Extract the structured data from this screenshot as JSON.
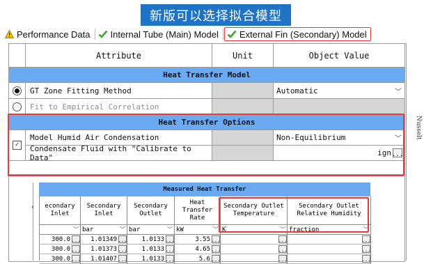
{
  "banner": {
    "text": "新版可以选择拟合模型"
  },
  "tabs": [
    {
      "label": "Performance Data",
      "icon": "warning-icon"
    },
    {
      "label": "Internal Tube (Main) Model",
      "icon": "check-icon"
    },
    {
      "label": "External Fin (Secondary) Model",
      "icon": "check-icon"
    }
  ],
  "grid": {
    "headers": {
      "attribute": "Attribute",
      "unit": "Unit",
      "value": "Object Value"
    },
    "sections": {
      "model": "Heat Transfer Model",
      "options": "Heat Transfer Options"
    },
    "rows": {
      "gt_zone": {
        "label": "GT Zone Fitting Method",
        "value": "Automatic"
      },
      "fit_empirical": {
        "label": "Fit to Empirical Correlation"
      },
      "humid_air": {
        "label": "Model Humid Air Condensation",
        "value": "Non-Equilibrium"
      },
      "condensate": {
        "label": "Condensate Fluid with \"Calibrate to Data\"",
        "value": "ign"
      }
    }
  },
  "side_label": "Nusselt",
  "ellipsis": "...",
  "measured": {
    "title": "Measured Heat Transfer",
    "columns": [
      {
        "header": "econdary\nInlet",
        "unit": "",
        "values": [
          "300.0",
          "300.0",
          "300.0"
        ]
      },
      {
        "header": "Secondary\nInlet",
        "unit": "bar",
        "values": [
          "1.01349",
          "1.01373",
          "1.01407"
        ]
      },
      {
        "header": "Secondary\nOutlet",
        "unit": "bar",
        "values": [
          "1.0133",
          "1.0133",
          "1.0133"
        ]
      },
      {
        "header": "Heat Transfer\nRate",
        "unit": "kW",
        "values": [
          "3.55",
          "4.65",
          "5.6"
        ]
      },
      {
        "header": "Secondary Outlet\nTemperature",
        "unit": "K",
        "values": [
          "",
          "",
          ""
        ]
      },
      {
        "header": "Secondary Outlet\nRelative Humidity",
        "unit": "fraction",
        "values": [
          "",
          "",
          ""
        ]
      }
    ]
  },
  "colors": {
    "section": "#6aaaf3",
    "highlight": "#e43b3b",
    "banner": "#1f73c4"
  }
}
